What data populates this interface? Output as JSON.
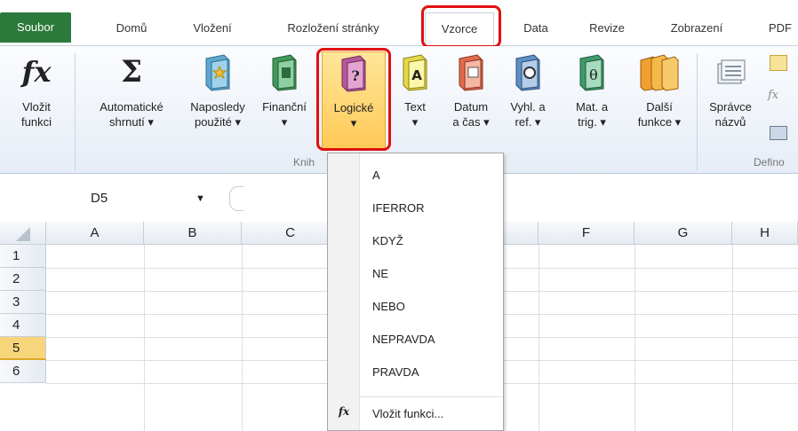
{
  "tabs": [
    "Soubor",
    "Domů",
    "Vložení",
    "Rozložení stránky",
    "Vzorce",
    "Data",
    "Revize",
    "Zobrazení",
    "PDF"
  ],
  "ribbon": {
    "insert_function": [
      "Vložit",
      "funkci"
    ],
    "autosum": [
      "Automatické",
      "shrnutí ▾"
    ],
    "recent": [
      "Naposledy",
      "použité ▾"
    ],
    "financial": [
      "Finanční",
      "▾"
    ],
    "logical": [
      "Logické",
      "▾"
    ],
    "text": [
      "Text",
      "▾"
    ],
    "datetime": [
      "Datum",
      "a čas ▾"
    ],
    "lookup": [
      "Vyhl. a",
      "ref. ▾"
    ],
    "math": [
      "Mat. a",
      "trig. ▾"
    ],
    "more": [
      "Další",
      "funkce ▾"
    ],
    "name_manager": [
      "Správce",
      "názvů"
    ],
    "group_library": "Knih",
    "group_defined": "Defino"
  },
  "formula_bar": {
    "name_box": "D5",
    "dropdown_arrow": "▼"
  },
  "grid": {
    "columns": [
      "A",
      "B",
      "C",
      "F",
      "G",
      "H"
    ],
    "rows": [
      "1",
      "2",
      "3",
      "4",
      "5",
      "6"
    ],
    "selected_row": "5"
  },
  "menu": {
    "items": [
      "A",
      "IFERROR",
      "KDYŽ",
      "NE",
      "NEBO",
      "NEPRAVDA",
      "PRAVDA"
    ],
    "insert_function": "Vložit funkci..."
  },
  "icons": {
    "fx": "fx",
    "sigma": "Σ",
    "question": "?",
    "letter_a": "A",
    "theta": "θ"
  },
  "colors": {
    "file_tab": "#2c7a3b",
    "highlight": "#e01010",
    "pressed": "#ffc955"
  }
}
